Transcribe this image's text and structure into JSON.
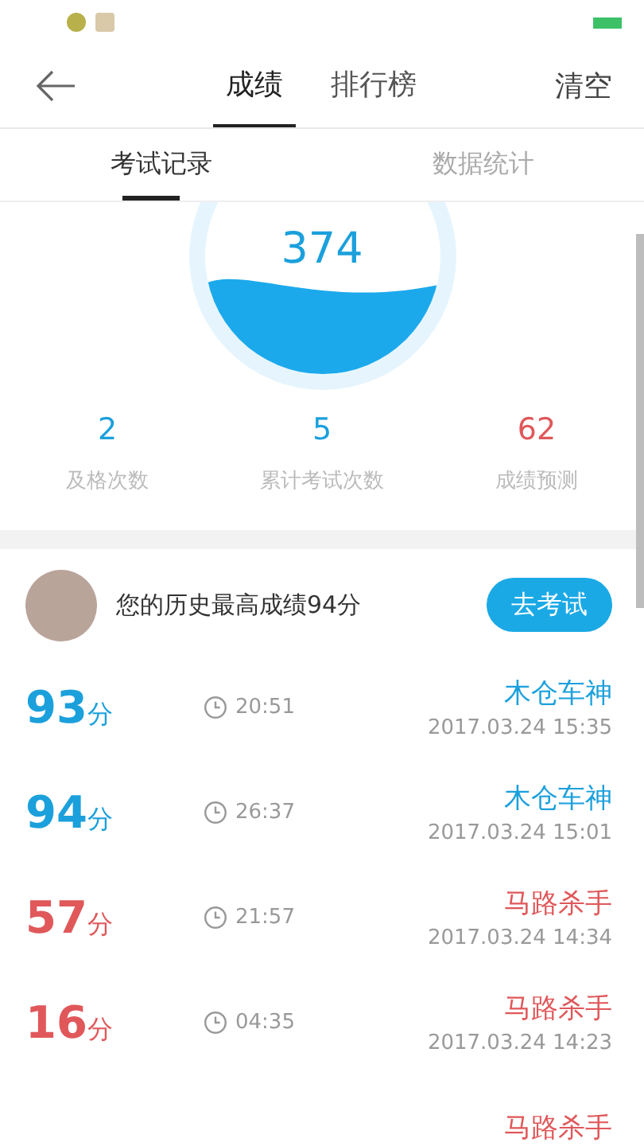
{
  "header": {
    "tabs": [
      {
        "label": "成绩",
        "selected": true
      },
      {
        "label": "排行榜",
        "selected": false
      }
    ],
    "action": "清空"
  },
  "subtabs": [
    {
      "label": "考试记录",
      "selected": true
    },
    {
      "label": "数据统计",
      "selected": false
    }
  ],
  "gauge": {
    "value": "374"
  },
  "stats": [
    {
      "value": "2",
      "label": "及格次数",
      "passed": true
    },
    {
      "value": "5",
      "label": "累计考试次数",
      "passed": true
    },
    {
      "value": "62",
      "label": "成绩预测",
      "passed": false
    }
  ],
  "best": {
    "text": "您的历史最高成绩94分",
    "button": "去考试"
  },
  "records": [
    {
      "score": "93",
      "unit": "分",
      "duration": "20:51",
      "name": "木仓车神",
      "date": "2017.03.24  15:35",
      "passed": true
    },
    {
      "score": "94",
      "unit": "分",
      "duration": "26:37",
      "name": "木仓车神",
      "date": "2017.03.24  15:01",
      "passed": true
    },
    {
      "score": "57",
      "unit": "分",
      "duration": "21:57",
      "name": "马路杀手",
      "date": "2017.03.24  14:34",
      "passed": false
    },
    {
      "score": "16",
      "unit": "分",
      "duration": "04:35",
      "name": "马路杀手",
      "date": "2017.03.24  14:23",
      "passed": false
    },
    {
      "name": "马路杀手",
      "passed": false
    }
  ]
}
